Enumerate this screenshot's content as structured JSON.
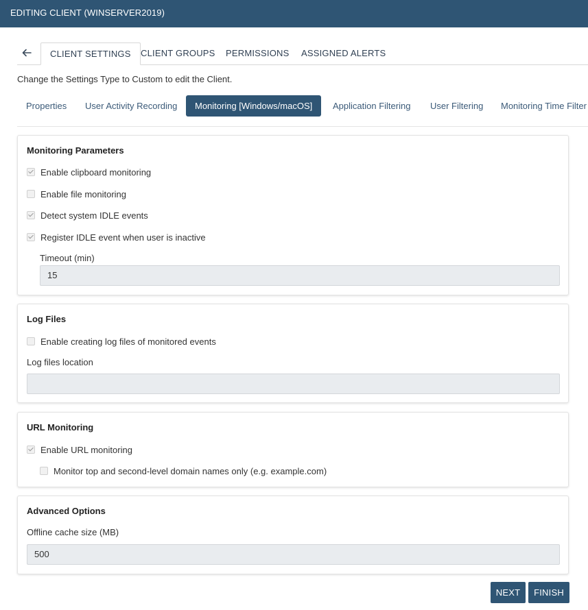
{
  "window": {
    "title": "EDITING CLIENT (WINSERVER2019)"
  },
  "tabs": [
    {
      "label": "CLIENT SETTINGS",
      "active": true
    },
    {
      "label": "CLIENT GROUPS"
    },
    {
      "label": "PERMISSIONS"
    },
    {
      "label": "ASSIGNED ALERTS"
    }
  ],
  "hint": "Change the Settings Type to Custom to edit the Client.",
  "subtabs": [
    {
      "label": "Properties"
    },
    {
      "label": "User Activity Recording"
    },
    {
      "label": "Monitoring [Windows/macOS]",
      "active": true
    },
    {
      "label": "Application Filtering"
    },
    {
      "label": "User Filtering"
    },
    {
      "label": "Monitoring Time Filter"
    }
  ],
  "monitoring_parameters": {
    "title": "Monitoring Parameters",
    "options": [
      {
        "label": "Enable clipboard monitoring",
        "checked": true
      },
      {
        "label": "Enable file monitoring",
        "checked": false
      },
      {
        "label": "Detect system IDLE events",
        "checked": true
      },
      {
        "label": "Register IDLE event when user is inactive",
        "checked": true
      }
    ],
    "timeout_label": "Timeout (min)",
    "timeout_value": "15"
  },
  "log_files": {
    "title": "Log Files",
    "option": {
      "label": "Enable creating log files of monitored events",
      "checked": false
    },
    "location_label": "Log files location",
    "location_value": ""
  },
  "url_monitoring": {
    "title": "URL Monitoring",
    "enable": {
      "label": "Enable URL monitoring",
      "checked": true
    },
    "domain_only": {
      "label": "Monitor top and second-level domain names only (e.g. example.com)",
      "checked": false
    }
  },
  "advanced": {
    "title": "Advanced Options",
    "cache_label": "Offline cache size (MB)",
    "cache_value": "500"
  },
  "buttons": {
    "next": "NEXT",
    "finish": "FINISH"
  },
  "colors": {
    "header": "#2f5574",
    "accent": "#2f5574"
  },
  "icons": {
    "back": "arrow-left-icon",
    "checkbox": "checkmark-icon"
  }
}
